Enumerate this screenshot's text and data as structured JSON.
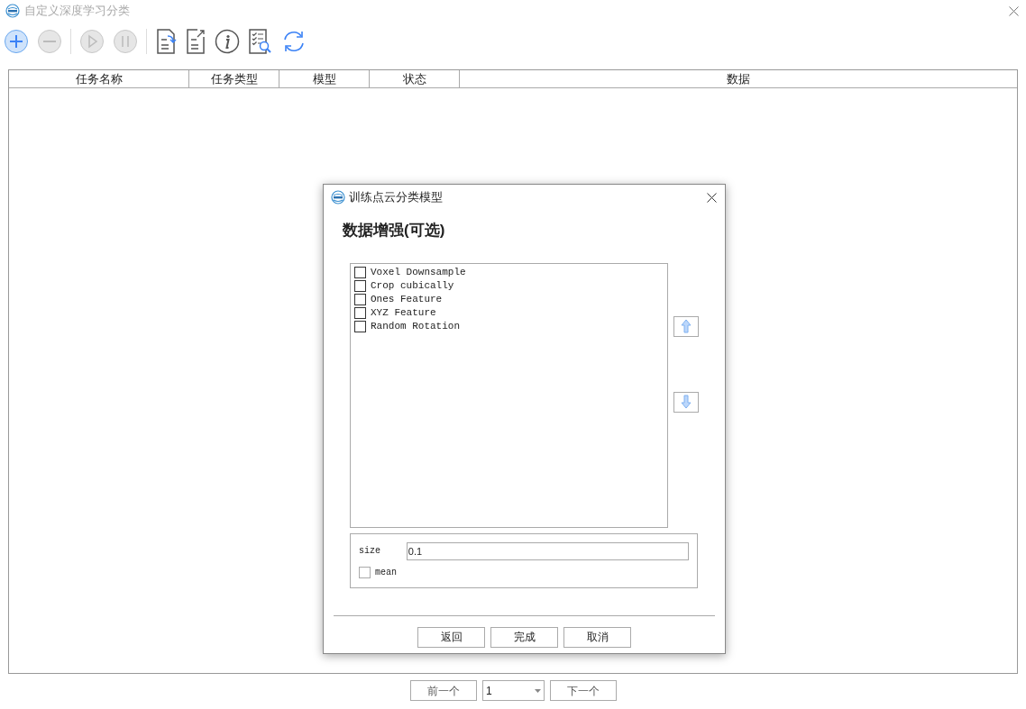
{
  "window": {
    "title": "自定义深度学习分类"
  },
  "toolbar": [
    {
      "kind": "add",
      "disabled": false
    },
    {
      "kind": "remove",
      "disabled": true
    },
    {
      "kind": "play",
      "disabled": true
    },
    {
      "kind": "pause",
      "disabled": true
    },
    {
      "kind": "import",
      "disabled": false
    },
    {
      "kind": "export",
      "disabled": false
    },
    {
      "kind": "info",
      "disabled": false
    },
    {
      "kind": "checklist",
      "disabled": false
    },
    {
      "kind": "refresh",
      "disabled": false
    }
  ],
  "table": {
    "columns": [
      "任务名称",
      "任务类型",
      "模型",
      "状态",
      "数据"
    ]
  },
  "dialog": {
    "title": "训练点云分类模型",
    "heading": "数据增强(可选)",
    "options": [
      {
        "label": "Voxel Downsample",
        "checked": false
      },
      {
        "label": "Crop cubically",
        "checked": false
      },
      {
        "label": "Ones Feature",
        "checked": false
      },
      {
        "label": "XYZ Feature",
        "checked": false
      },
      {
        "label": "Random Rotation",
        "checked": false
      }
    ],
    "params": {
      "size_label": "size",
      "size_value": "0.1",
      "mean_label": "mean",
      "mean_checked": false
    },
    "buttons": [
      "返回",
      "完成",
      "取消"
    ]
  },
  "pager": {
    "prev": "前一个",
    "page": "1",
    "next": "下一个"
  }
}
